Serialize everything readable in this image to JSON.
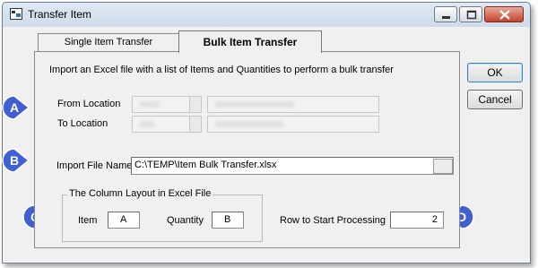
{
  "window": {
    "title": "Transfer Item",
    "accent_color": "#4a64d8"
  },
  "tabs": [
    {
      "label": "Single Item Transfer",
      "active": false
    },
    {
      "label": "Bulk Item Transfer",
      "active": true
    }
  ],
  "panel": {
    "description": "Import an Excel file with a list of Items and Quantities to perform a bulk transfer",
    "from_location_label": "From Location",
    "to_location_label": "To Location",
    "import_file_label": "Import File Name",
    "import_file_value": "C:\\TEMP\\Item Bulk Transfer.xlsx",
    "group_title": "The Column Layout in Excel File",
    "item_label": "Item",
    "item_value": "A",
    "quantity_label": "Quantity",
    "quantity_value": "B",
    "row_start_label": "Row to Start Processing",
    "row_start_value": "2"
  },
  "buttons": {
    "ok": "OK",
    "cancel": "Cancel"
  },
  "callouts": {
    "a": "A",
    "b": "B",
    "c": "C",
    "d": "D"
  }
}
